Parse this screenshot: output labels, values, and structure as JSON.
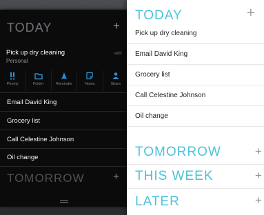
{
  "dark_panel": {
    "header": "TODAY",
    "plus": "+",
    "selected": {
      "title": "Pick up dry cleaning",
      "subtitle": "Personal",
      "edit_label": "edit"
    },
    "actions": [
      {
        "label": "Priority",
        "icon": "exclamation-icon"
      },
      {
        "label": "Folder",
        "icon": "folder-icon"
      },
      {
        "label": "Reminder",
        "icon": "bell-icon"
      },
      {
        "label": "Notes",
        "icon": "note-icon"
      },
      {
        "label": "Share",
        "icon": "person-icon"
      }
    ],
    "items": [
      "Email David King",
      "Grocery list",
      "Call Celestine Johnson",
      "Oil change"
    ],
    "next_section": "TOMORROW",
    "next_plus": "+"
  },
  "light_panel": {
    "header": "TODAY",
    "plus": "+",
    "items": [
      "Pick up dry cleaning",
      "Email David King",
      "Grocery list",
      "Call Celestine Johnson",
      "Oil change"
    ],
    "sections": [
      {
        "label": "TOMORROW",
        "plus": "+"
      },
      {
        "label": "THIS WEEK",
        "plus": "+"
      },
      {
        "label": "LATER",
        "plus": "+"
      }
    ]
  },
  "colors": {
    "accent": "#4cc2d8",
    "dark_bg": "#0b0b0c",
    "light_bg": "#ffffff",
    "icon_blue": "#2f8fd0"
  }
}
